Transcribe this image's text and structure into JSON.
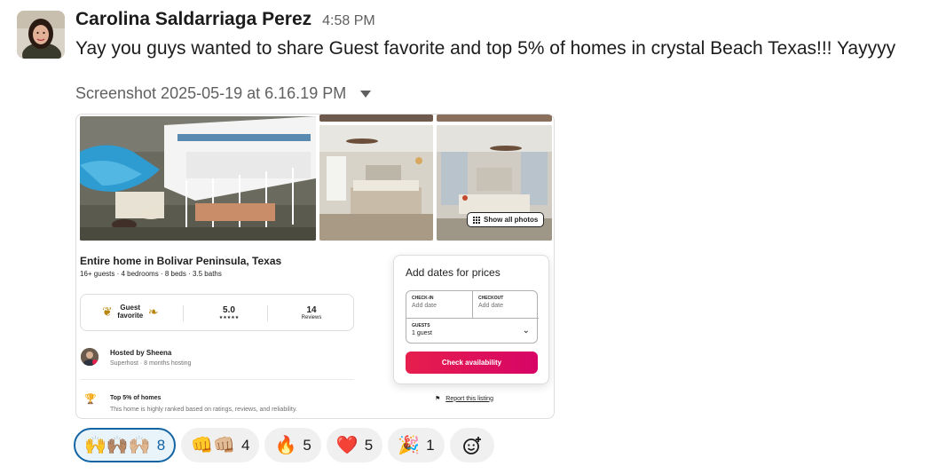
{
  "message": {
    "sender": "Carolina Saldarriaga Perez",
    "time": "4:58 PM",
    "text": "Yay you guys wanted to share Guest favorite and top 5% of homes in crystal Beach Texas!!! Yayyyy",
    "attachment_name": "Screenshot 2025-05-19 at 6.16.19 PM"
  },
  "listing": {
    "show_all_photos": "Show all photos",
    "title": "Entire home in Bolivar Peninsula, Texas",
    "subtitle": "16+ guests · 4 bedrooms · 8 beds · 3.5 baths",
    "guest_favorite": "Guest favorite",
    "rating": "5.0",
    "stars": "★★★★★",
    "reviews_count": "14",
    "reviews_label": "Reviews",
    "host_name": "Hosted by Sheena",
    "host_sub": "Superhost · 8 months hosting",
    "top_title": "Top 5% of homes",
    "top_sub": "This home is highly ranked based on ratings, reviews, and reliability.",
    "report": "Report this listing"
  },
  "booking": {
    "title": "Add dates for prices",
    "checkin_label": "CHECK-IN",
    "checkin_value": "Add date",
    "checkout_label": "CHECKOUT",
    "checkout_value": "Add date",
    "guests_label": "GUESTS",
    "guests_value": "1 guest",
    "button": "Check availability"
  },
  "reactions": [
    {
      "icon": "raising-hands-icon",
      "emoji": "🙌🙌🏽🙌🏼",
      "count": "8",
      "selected": true
    },
    {
      "icon": "fist-bump-icon",
      "emoji": "👊👊🏼",
      "count": "4",
      "selected": false
    },
    {
      "icon": "fire-icon",
      "emoji": "🔥",
      "count": "5",
      "selected": false
    },
    {
      "icon": "heart-icon",
      "emoji": "❤️",
      "count": "5",
      "selected": false
    },
    {
      "icon": "party-popper-icon",
      "emoji": "🎉",
      "count": "1",
      "selected": false
    }
  ],
  "colors": {
    "accent": "#1264a3",
    "airbnb_pink": "#e61e4d"
  }
}
